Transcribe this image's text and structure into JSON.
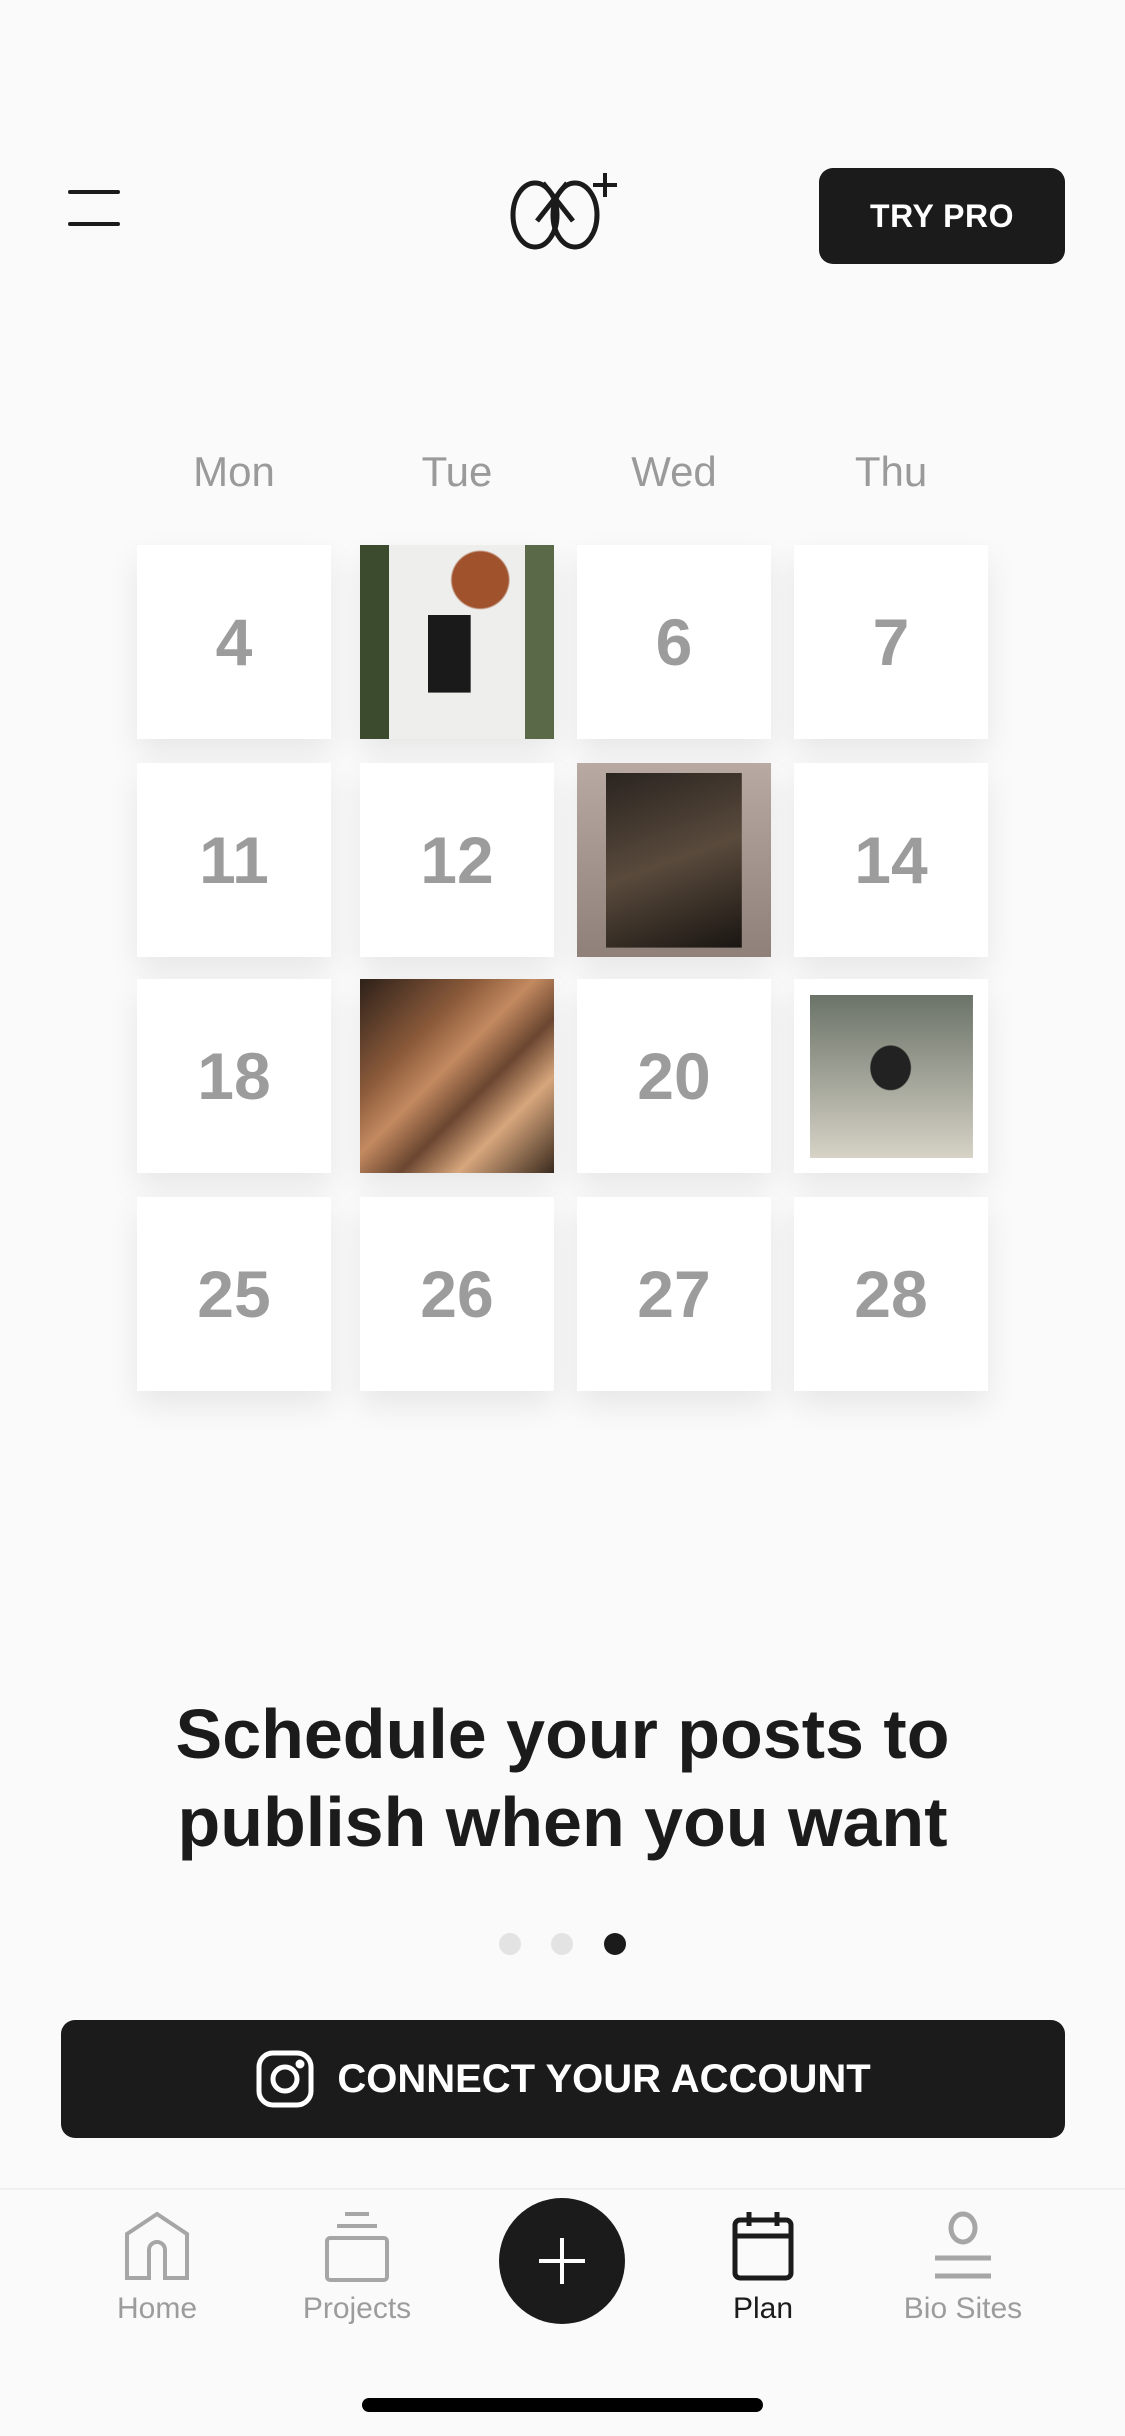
{
  "header": {
    "try_pro_label": "TRY PRO",
    "logo": "unfold-plus-logo",
    "menu_icon": "hamburger-icon"
  },
  "calendar": {
    "days": [
      "Mon",
      "Tue",
      "Wed",
      "Thu"
    ],
    "cells": [
      {
        "label": "4"
      },
      {
        "label": "",
        "image": "woman-portrait-photo"
      },
      {
        "label": "6"
      },
      {
        "label": "7"
      },
      {
        "label": "11"
      },
      {
        "label": "12"
      },
      {
        "label": "",
        "image": "hair-comb-photo"
      },
      {
        "label": "14"
      },
      {
        "label": "18"
      },
      {
        "label": "",
        "image": "sand-dune-photo"
      },
      {
        "label": "20"
      },
      {
        "label": "",
        "image": "palm-tree-photo"
      },
      {
        "label": "25"
      },
      {
        "label": "26"
      },
      {
        "label": "27"
      },
      {
        "label": "28"
      }
    ]
  },
  "onboarding": {
    "headline_line1": "Schedule your posts to",
    "headline_line2": "publish when you want",
    "page_count": 3,
    "active_page": 3
  },
  "connect": {
    "label": "CONNECT YOUR ACCOUNT",
    "icon": "instagram-icon"
  },
  "nav": {
    "items": [
      {
        "label": "Home",
        "icon": "home-icon"
      },
      {
        "label": "Projects",
        "icon": "projects-icon"
      },
      {
        "label": "",
        "icon": "plus-icon"
      },
      {
        "label": "Plan",
        "icon": "calendar-icon",
        "active": true
      },
      {
        "label": "Bio Sites",
        "icon": "person-icon"
      }
    ]
  },
  "colors": {
    "primary": "#1b1b1b",
    "muted": "#9c9c9c",
    "background": "#fafafa"
  }
}
